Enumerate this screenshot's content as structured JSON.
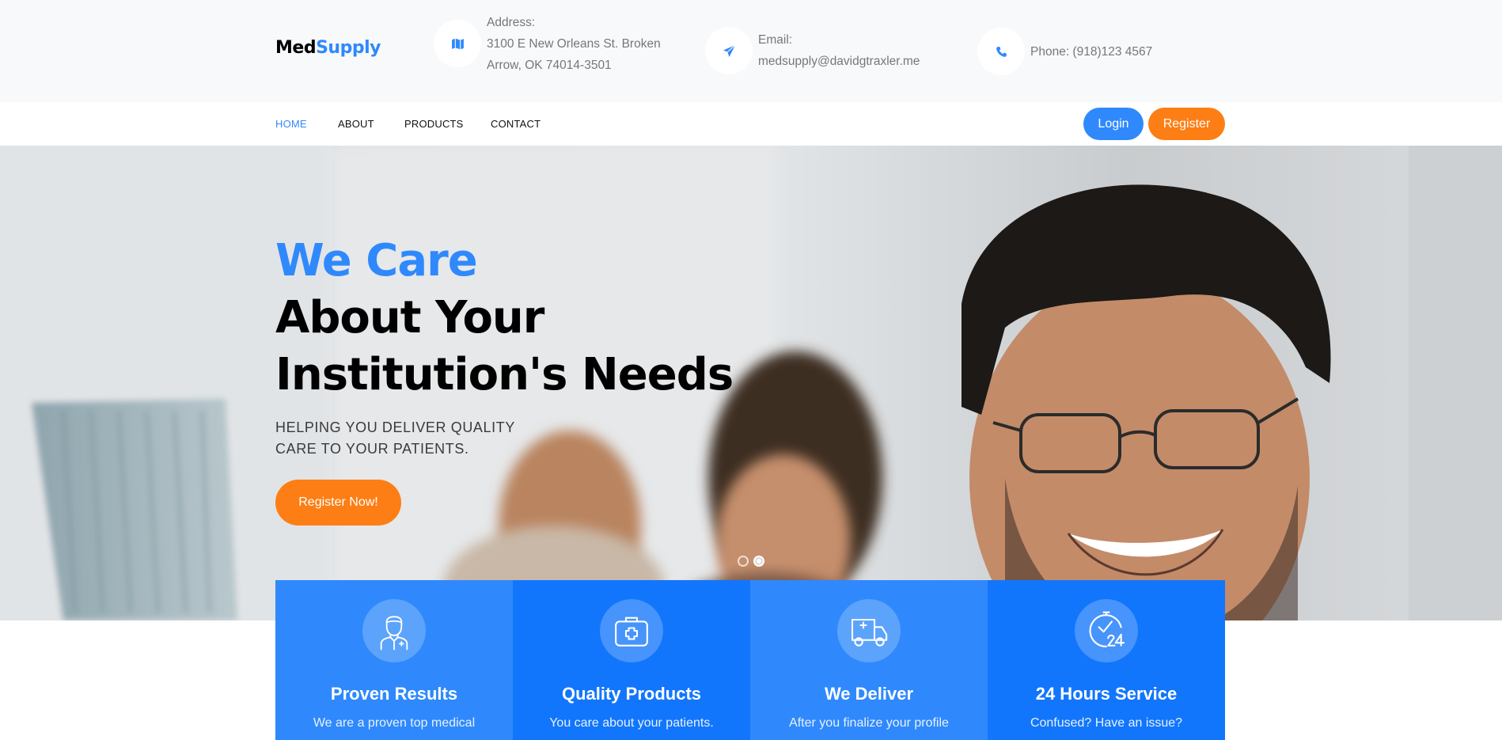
{
  "brand": {
    "name_part1": "Med",
    "name_part2": "Supply"
  },
  "contact": {
    "address_label": "Address:",
    "address_line1": "3100 E New Orleans St. Broken",
    "address_line2": "Arrow, OK 74014-3501",
    "email_label": "Email:",
    "email_value": "medsupply@davidgtraxler.me",
    "phone_text": "Phone: (918)123 4567",
    "icons": [
      "map-icon",
      "paper-plane-icon",
      "phone-icon"
    ]
  },
  "nav": {
    "items": [
      {
        "label": "HOME",
        "active": true
      },
      {
        "label": "ABOUT",
        "active": false
      },
      {
        "label": "PRODUCTS",
        "active": false
      },
      {
        "label": "CONTACT",
        "active": false
      }
    ],
    "login_label": "Login",
    "register_label": "Register"
  },
  "hero": {
    "title_line1": "We Care",
    "title_line2": "About Your",
    "title_line3": "Institution's Needs",
    "subtitle": "HELPING YOU DELIVER QUALITY CARE TO YOUR PATIENTS.",
    "cta_label": "Register Now!",
    "slides_count": 2,
    "active_slide": 2
  },
  "features": [
    {
      "icon": "doctor-icon",
      "title": "Proven Results",
      "description": "We are a proven top medical"
    },
    {
      "icon": "first-aid-kit-icon",
      "title": "Quality Products",
      "description": "You care about your patients."
    },
    {
      "icon": "ambulance-icon",
      "title": "We Deliver",
      "description": "After you finalize your profile"
    },
    {
      "icon": "clock-24-icon",
      "title": "24 Hours Service",
      "description": "Confused? Have an issue?"
    }
  ],
  "colors": {
    "primary_blue": "#2f89fc",
    "dark_blue": "#1276fc",
    "orange": "#fd7e14",
    "topbar_bg": "#f8f9fa"
  }
}
